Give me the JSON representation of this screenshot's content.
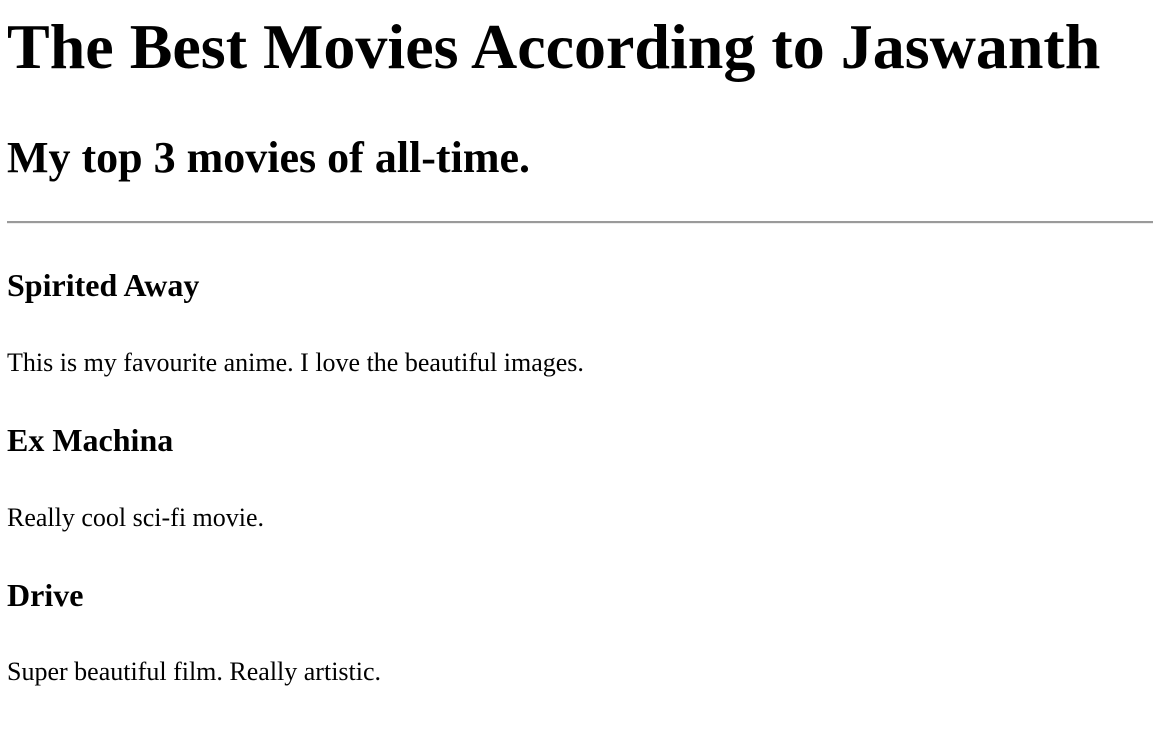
{
  "page": {
    "title": "The Best Movies According to Jaswanth",
    "subtitle": "My top 3 movies of all-time."
  },
  "movies": [
    {
      "title": "Spirited Away",
      "description": "This is my favourite anime. I love the beautiful images."
    },
    {
      "title": "Ex Machina",
      "description": "Really cool sci-fi movie."
    },
    {
      "title": "Drive",
      "description": "Super beautiful film. Really artistic."
    }
  ]
}
